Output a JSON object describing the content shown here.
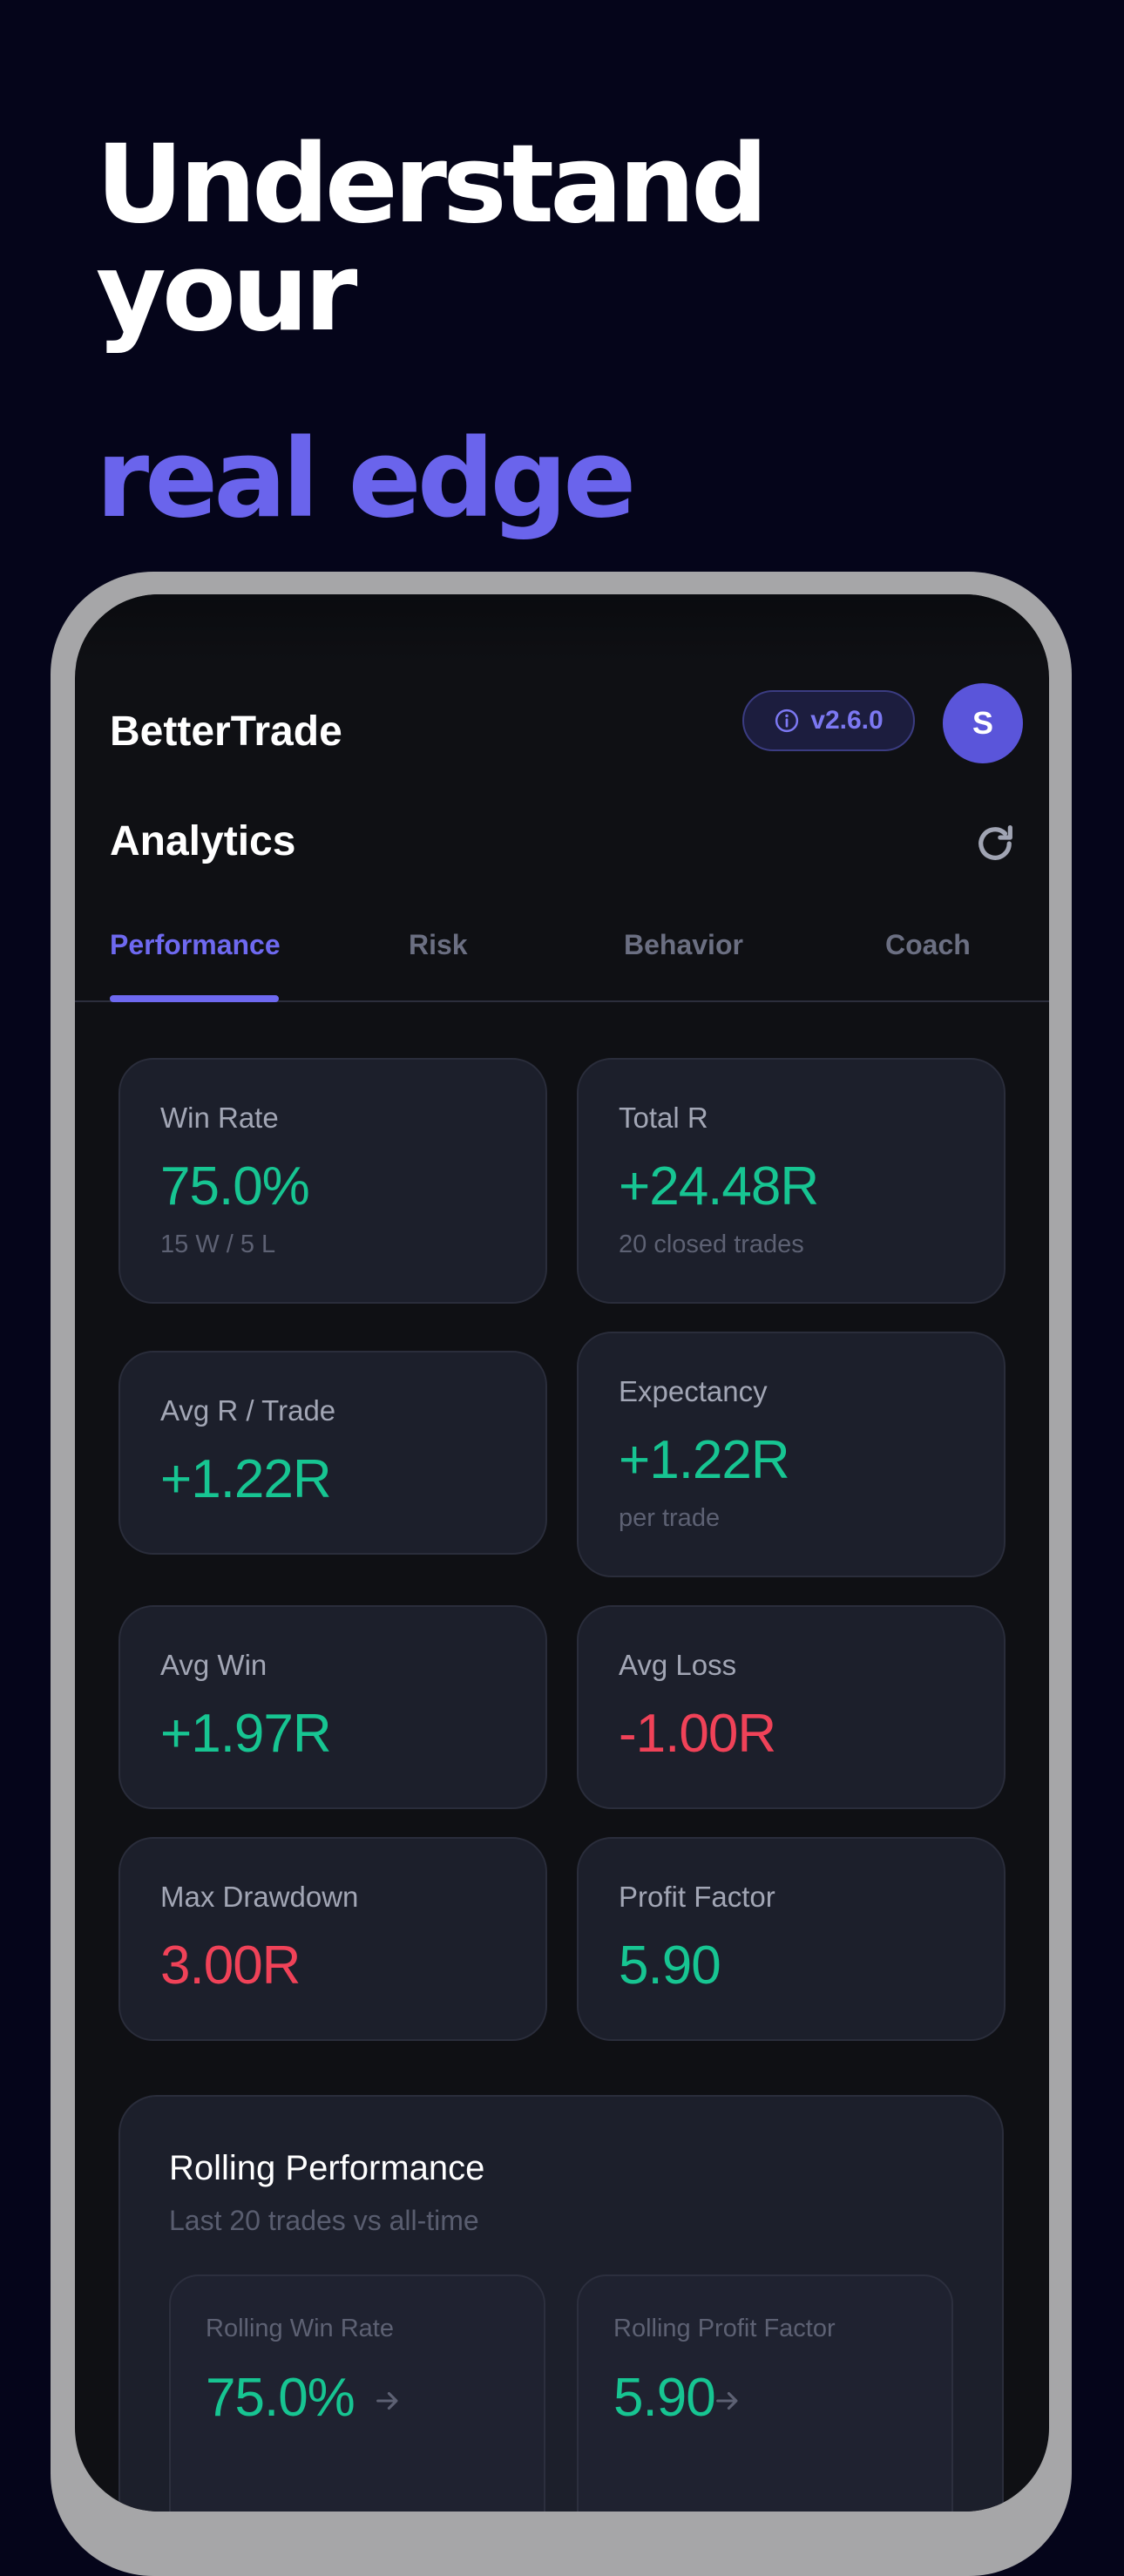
{
  "hero": {
    "line1": "Understand your",
    "line2": "real edge"
  },
  "app": {
    "name": "BetterTrade",
    "version": "v2.6.0",
    "avatar_initial": "S",
    "page_title": "Analytics"
  },
  "tabs": [
    {
      "label": "Performance",
      "active": true
    },
    {
      "label": "Risk",
      "active": false
    },
    {
      "label": "Behavior",
      "active": false
    },
    {
      "label": "Coach",
      "active": false
    }
  ],
  "metrics": {
    "win_rate": {
      "label": "Win Rate",
      "value": "75.0%",
      "sub": "15 W / 5 L"
    },
    "total_r": {
      "label": "Total R",
      "value": "+24.48R",
      "sub": "20 closed trades"
    },
    "avg_r_trade": {
      "label": "Avg R / Trade",
      "value": "+1.22R"
    },
    "expectancy": {
      "label": "Expectancy",
      "value": "+1.22R",
      "sub": "per trade"
    },
    "avg_win": {
      "label": "Avg Win",
      "value": "+1.97R"
    },
    "avg_loss": {
      "label": "Avg Loss",
      "value": "-1.00R"
    },
    "max_drawdown": {
      "label": "Max Drawdown",
      "value": "3.00R"
    },
    "profit_factor": {
      "label": "Profit Factor",
      "value": "5.90"
    }
  },
  "rolling": {
    "title": "Rolling Performance",
    "subtitle": "Last 20 trades vs all-time",
    "win_rate": {
      "label": "Rolling Win Rate",
      "value": "75.0%"
    },
    "profit_factor": {
      "label": "Rolling Profit Factor",
      "value": "5.90"
    }
  },
  "colors": {
    "accent": "#6e69f0",
    "positive": "#17c592",
    "negative": "#f04258",
    "background": "#05051a",
    "card": "#1c1f2b"
  },
  "icons": [
    "info-icon",
    "refresh-icon",
    "arrow-right-icon"
  ]
}
